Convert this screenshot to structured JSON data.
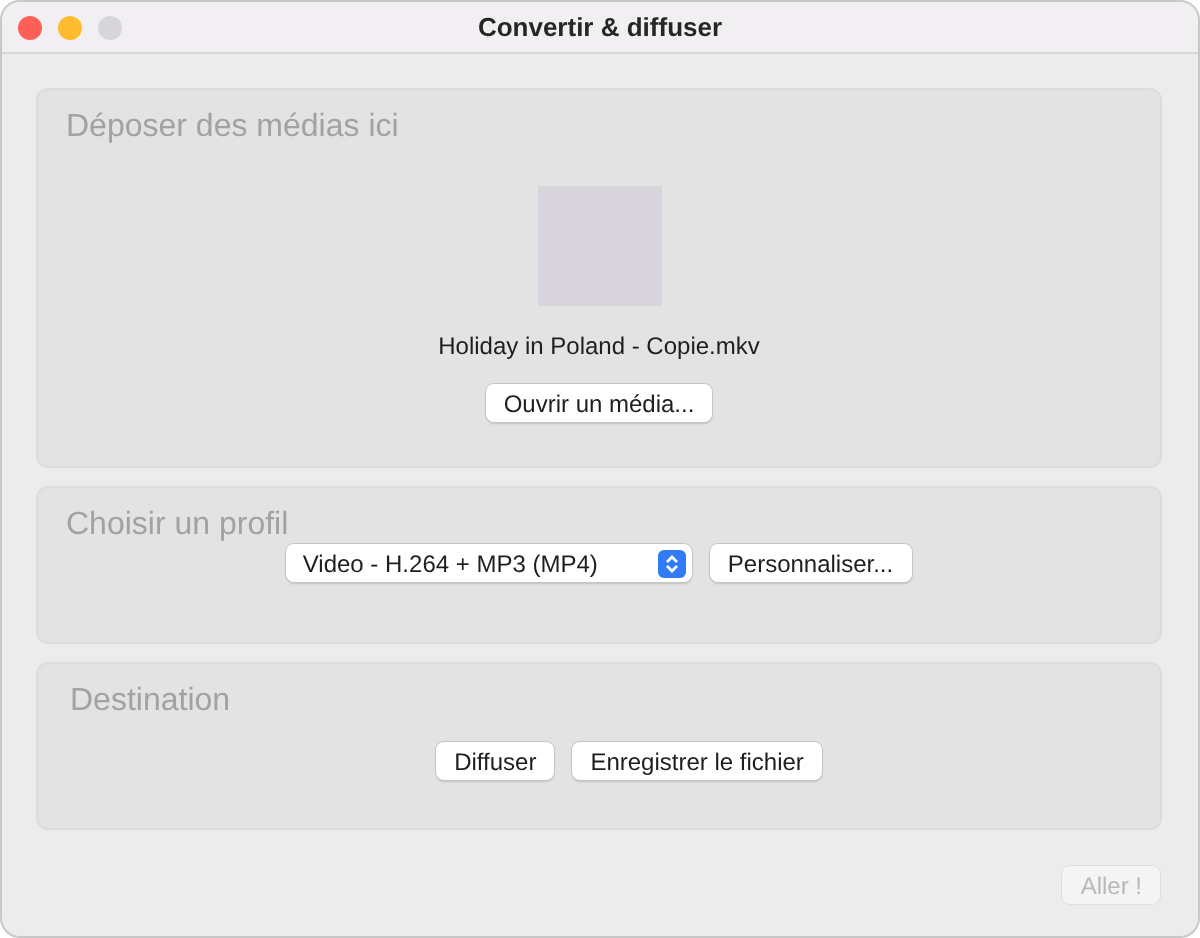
{
  "window": {
    "title": "Convertir & diffuser"
  },
  "drop_section": {
    "title": "Déposer des médias ici",
    "file_name": "Holiday in Poland - Copie.mkv",
    "open_button": {
      "label": "Ouvrir un média...",
      "disabled": false
    }
  },
  "profile_section": {
    "title": "Choisir un profil",
    "profile_select": {
      "value": "Video - H.264 + MP3 (MP4)"
    },
    "customize_button": {
      "label": "Personnaliser...",
      "disabled": false
    }
  },
  "destination_section": {
    "title": "Destination",
    "buttons": [
      {
        "label": "Diffuser",
        "disabled": false
      },
      {
        "label": "Enregistrer le fichier",
        "disabled": false
      }
    ]
  },
  "go_button": {
    "label": "Aller !",
    "disabled": true
  }
}
